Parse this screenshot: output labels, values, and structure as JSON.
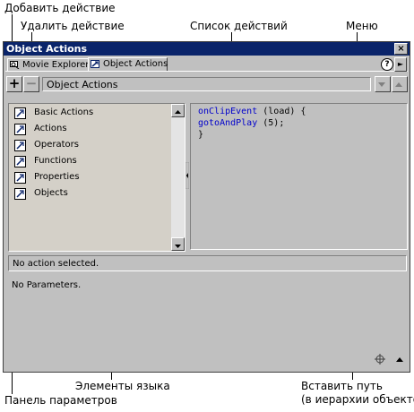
{
  "callouts": {
    "add_action": "Добавить действие",
    "delete_action": "Удалить действие",
    "actions_list": "Список действий",
    "menu": "Меню",
    "language_elements": "Элементы языка",
    "insert_path_line1": "Вставить путь",
    "insert_path_line2": "(в иерархии объектов)",
    "params_panel": "Панель параметров"
  },
  "window": {
    "title": "Object Actions",
    "close_glyph": "×",
    "tabs": [
      {
        "label": "Movie Explorer",
        "active": false
      },
      {
        "label": "Object Actions",
        "active": true
      }
    ],
    "help_glyph": "?",
    "menu_glyph": "►"
  },
  "toolbar": {
    "add_glyph": "+",
    "delete_glyph": "−",
    "field_value": "Object Actions"
  },
  "toolbox": {
    "items": [
      {
        "label": "Basic Actions",
        "icon": "book-icon"
      },
      {
        "label": "Actions",
        "icon": "book-icon"
      },
      {
        "label": "Operators",
        "icon": "book-icon"
      },
      {
        "label": "Functions",
        "icon": "book-icon"
      },
      {
        "label": "Properties",
        "icon": "book-icon"
      },
      {
        "label": "Objects",
        "icon": "book-icon"
      }
    ]
  },
  "code": {
    "line1_kw": "onClipEvent",
    "line1_rest": " (load) {",
    "line2_kw": " gotoAndPlay",
    "line2_rest": " (5);",
    "line3": "}"
  },
  "status": {
    "text": "No action selected."
  },
  "params": {
    "text": "No Parameters."
  },
  "colors": {
    "titlebar": "#0a246a",
    "panel": "#c0c0c0",
    "keyword": "#0000cc"
  }
}
